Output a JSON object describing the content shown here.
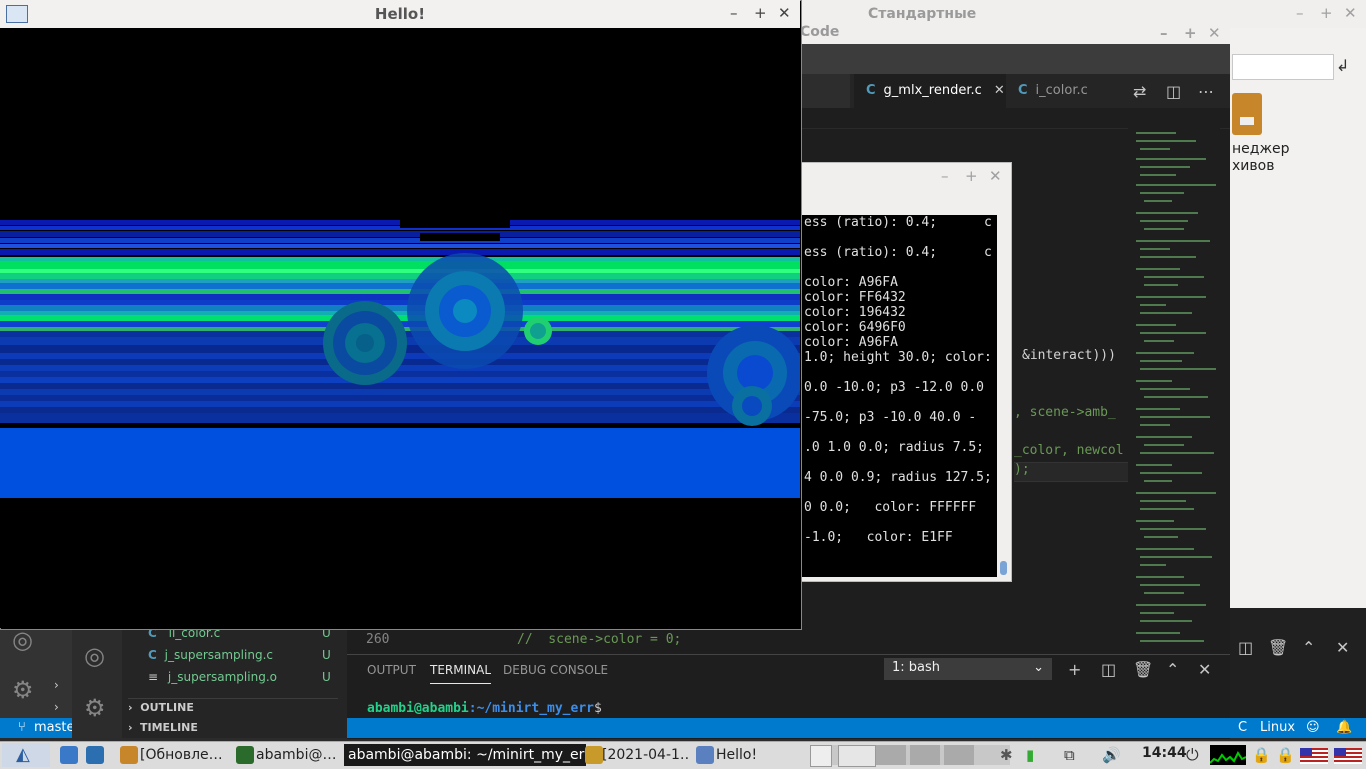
{
  "file_manager": {
    "title": "Стандартные",
    "icon_label": "неджер\nхивов",
    "controls": [
      "–",
      "+",
      "✕"
    ]
  },
  "vscode": {
    "title": "Code",
    "tabs": [
      {
        "icon": "C",
        "label": "g_mlx_render.c"
      },
      {
        "icon": "C",
        "label": "i_color.c"
      }
    ],
    "code_fragments": [
      "&interact)))",
      ", scene->amb_",
      "_color, newcol",
      ");"
    ],
    "line_number": "260",
    "line_code": "//  scene->color = 0;",
    "explorer_files": [
      {
        "icon": "C",
        "name": "ii_color.c",
        "status": "U"
      },
      {
        "icon": "C",
        "name": "j_supersampling.c",
        "status": "U"
      },
      {
        "icon": "≡",
        "name": "j_supersampling.o",
        "status": "U"
      }
    ],
    "sections": [
      "OUTLINE",
      "TIMELINE"
    ],
    "panel_tabs": [
      "OUTPUT",
      "TERMINAL",
      "DEBUG CONSOLE"
    ],
    "shell_select": "1: bash",
    "prompt_user": "abambi@abambi",
    "prompt_path": ":~/minirt_my_err",
    "prompt_symbol": "$",
    "status_branch": "master",
    "status_lang": "C",
    "status_os": "Linux"
  },
  "floating_terminal": {
    "lines": [
      "ess (ratio): 0.4;      c",
      "ess (ratio): 0.4;      c",
      "color: A96FA",
      "color: FF6432",
      "color: 196432",
      "color: 6496F0",
      "color: A96FA",
      "1.0; height 30.0; color:",
      "0.0 -10.0; p3 -12.0 0.0",
      "-75.0; p3 -10.0 40.0 -",
      ".0 1.0 0.0; radius 7.5;",
      "4 0.0 0.9; radius 127.5;",
      "0 0.0;   color: FFFFFF",
      "-1.0;   color: E1FF"
    ]
  },
  "hello_window": {
    "title": "Hello!"
  },
  "taskbar": {
    "items": [
      "[Обновле…",
      "abambi@…",
      "abambi@abambi: ~/minirt_my_err",
      "[2021-04-1…",
      "Hello!"
    ],
    "clock": "14:44"
  },
  "colors": {
    "vscode_status": "#007acc",
    "render_blue": "#0050e0",
    "render_green": "#00ff60"
  }
}
